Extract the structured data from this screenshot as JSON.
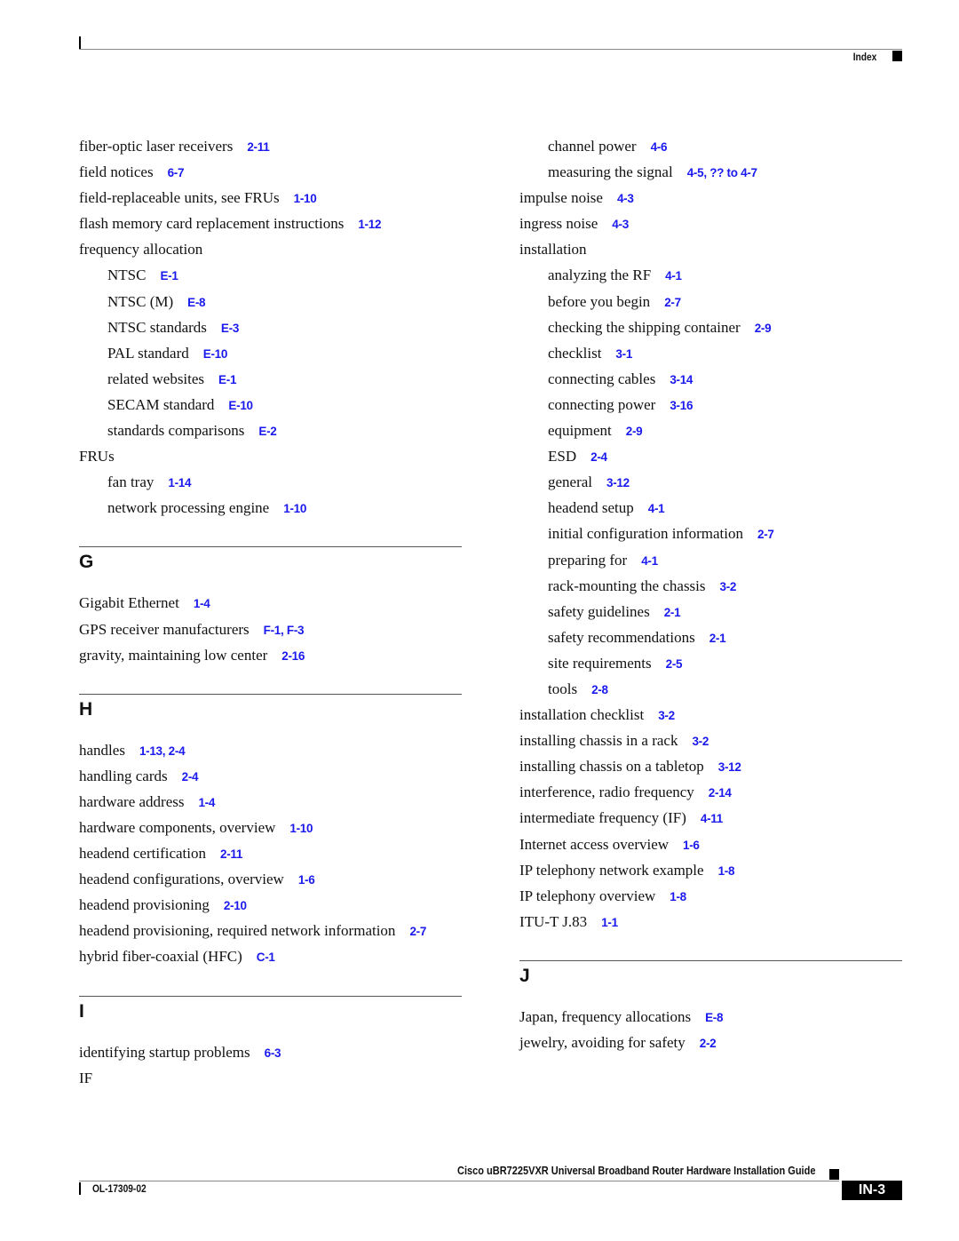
{
  "header": {
    "section_label": "Index"
  },
  "left_column": {
    "entries": [
      {
        "term": "fiber-optic laser receivers",
        "pages": "2-11"
      },
      {
        "term": "field notices",
        "pages": "6-7"
      },
      {
        "term": "field-replaceable units, see FRUs",
        "pages": "1-10"
      },
      {
        "term": "flash memory card replacement instructions",
        "pages": "1-12"
      },
      {
        "term": "frequency allocation",
        "pages": ""
      },
      {
        "term": "NTSC",
        "pages": "E-1",
        "sub": true
      },
      {
        "term": "NTSC (M)",
        "pages": "E-8",
        "sub": true
      },
      {
        "term": "NTSC standards",
        "pages": "E-3",
        "sub": true
      },
      {
        "term": "PAL standard",
        "pages": "E-10",
        "sub": true
      },
      {
        "term": "related websites",
        "pages": "E-1",
        "sub": true
      },
      {
        "term": "SECAM standard",
        "pages": "E-10",
        "sub": true
      },
      {
        "term": "standards comparisons",
        "pages": "E-2",
        "sub": true
      },
      {
        "term": "FRUs",
        "pages": ""
      },
      {
        "term": "fan tray",
        "pages": "1-14",
        "sub": true
      },
      {
        "term": "network processing engine",
        "pages": "1-10",
        "sub": true
      }
    ],
    "sections": [
      {
        "letter": "G",
        "entries": [
          {
            "term": "Gigabit Ethernet",
            "pages": "1-4"
          },
          {
            "term": "GPS receiver manufacturers",
            "pages": "F-1, F-3"
          },
          {
            "term": "gravity, maintaining low center",
            "pages": "2-16"
          }
        ]
      },
      {
        "letter": "H",
        "entries": [
          {
            "term": "handles",
            "pages": "1-13, 2-4"
          },
          {
            "term": "handling cards",
            "pages": "2-4"
          },
          {
            "term": "hardware address",
            "pages": "1-4"
          },
          {
            "term": "hardware components, overview",
            "pages": "1-10"
          },
          {
            "term": "headend certification",
            "pages": "2-11"
          },
          {
            "term": "headend configurations, overview",
            "pages": "1-6"
          },
          {
            "term": "headend provisioning",
            "pages": "2-10"
          },
          {
            "term": "headend provisioning, required network information",
            "pages": "2-7"
          },
          {
            "term": "hybrid fiber-coaxial (HFC)",
            "pages": "C-1"
          }
        ]
      },
      {
        "letter": "I",
        "entries": [
          {
            "term": "identifying startup problems",
            "pages": "6-3"
          },
          {
            "term": "IF",
            "pages": ""
          }
        ]
      }
    ]
  },
  "right_column": {
    "entries": [
      {
        "term": "channel power",
        "pages": "4-6",
        "sub": true
      },
      {
        "term": "measuring the signal",
        "pages": "4-5, ?? to 4-7",
        "sub": true
      },
      {
        "term": "impulse noise",
        "pages": "4-3"
      },
      {
        "term": "ingress noise",
        "pages": "4-3"
      },
      {
        "term": "installation",
        "pages": ""
      },
      {
        "term": "analyzing the RF",
        "pages": "4-1",
        "sub": true
      },
      {
        "term": "before you begin",
        "pages": "2-7",
        "sub": true
      },
      {
        "term": "checking the shipping container",
        "pages": "2-9",
        "sub": true
      },
      {
        "term": "checklist",
        "pages": "3-1",
        "sub": true
      },
      {
        "term": "connecting cables",
        "pages": "3-14",
        "sub": true
      },
      {
        "term": "connecting power",
        "pages": "3-16",
        "sub": true
      },
      {
        "term": "equipment",
        "pages": "2-9",
        "sub": true
      },
      {
        "term": "ESD",
        "pages": "2-4",
        "sub": true
      },
      {
        "term": "general",
        "pages": "3-12",
        "sub": true
      },
      {
        "term": "headend setup",
        "pages": "4-1",
        "sub": true
      },
      {
        "term": "initial configuration information",
        "pages": "2-7",
        "sub": true
      },
      {
        "term": "preparing for",
        "pages": "4-1",
        "sub": true
      },
      {
        "term": "rack-mounting the chassis",
        "pages": "3-2",
        "sub": true
      },
      {
        "term": "safety guidelines",
        "pages": "2-1",
        "sub": true
      },
      {
        "term": "safety recommendations",
        "pages": "2-1",
        "sub": true
      },
      {
        "term": "site requirements",
        "pages": "2-5",
        "sub": true
      },
      {
        "term": "tools",
        "pages": "2-8",
        "sub": true
      },
      {
        "term": "installation checklist",
        "pages": "3-2"
      },
      {
        "term": "installing chassis in a rack",
        "pages": "3-2"
      },
      {
        "term": "installing chassis on a tabletop",
        "pages": "3-12"
      },
      {
        "term": "interference, radio frequency",
        "pages": "2-14"
      },
      {
        "term": "intermediate frequency (IF)",
        "pages": "4-11"
      },
      {
        "term": "Internet access overview",
        "pages": "1-6"
      },
      {
        "term": "IP telephony network example",
        "pages": "1-8"
      },
      {
        "term": "IP telephony overview",
        "pages": "1-8"
      },
      {
        "term": "ITU-T J.83",
        "pages": "1-1"
      }
    ],
    "sections": [
      {
        "letter": "J",
        "entries": [
          {
            "term": "Japan, frequency allocations",
            "pages": "E-8"
          },
          {
            "term": "jewelry, avoiding for safety",
            "pages": "2-2"
          }
        ]
      }
    ]
  },
  "footer": {
    "book_title": "Cisco uBR7225VXR Universal Broadband Router Hardware Installation Guide",
    "doc_number": "OL-17309-02",
    "page_number": "IN-3"
  },
  "colors": {
    "page_link": "#1a1aee",
    "text": "#111111"
  }
}
